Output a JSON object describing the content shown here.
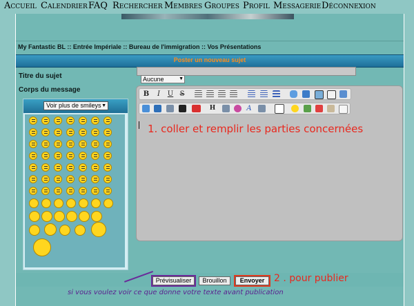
{
  "nav": {
    "items": [
      {
        "label": "Accueil"
      },
      {
        "label": "Calendrier"
      },
      {
        "label": "FAQ"
      },
      {
        "label": "Rechercher"
      },
      {
        "label": "Membres"
      },
      {
        "label": "Groupes"
      },
      {
        "label": "Profil"
      },
      {
        "label": "Messagerie"
      },
      {
        "label": "Déconnexion"
      }
    ]
  },
  "breadcrumb": "My Fantastic BL :: Entrée Impériale :: Bureau de l'immigration :: Vos Présentations",
  "form": {
    "header": "Poster un nouveau sujet",
    "subject_label": "Titre du sujet",
    "body_label": "Corps du message",
    "subject_value": "",
    "topic_type_selected": "Aucune"
  },
  "smileys": {
    "select_label": "Voir plus de smileys"
  },
  "toolbar": {
    "bold": "B",
    "italic": "I",
    "underline": "U",
    "strike": "S",
    "h": "H",
    "a": "A"
  },
  "annotations": {
    "step1": "1. coller et remplir les parties concernées",
    "step2": "2 . pour publier",
    "preview_note": "si vous voulez voir ce que donne votre texte avant publication"
  },
  "buttons": {
    "preview": "Prévisualiser",
    "draft": "Brouillon",
    "send": "Envoyer"
  },
  "colors": {
    "page_bg": "#8fc7c4",
    "header_text": "#ff8c1a",
    "annotation_red": "#e8281e",
    "annotation_purple": "#5a1f8f"
  }
}
